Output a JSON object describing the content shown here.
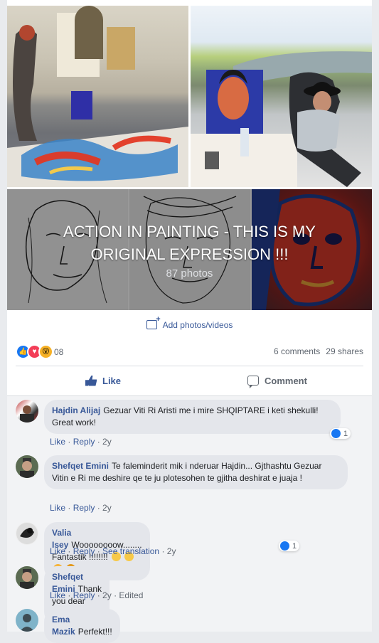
{
  "album": {
    "title": "ACTION IN PAINTING - THIS IS MY ORIGINAL EXPRESSION !!!",
    "count": "87 photos"
  },
  "post": {
    "add_photos": "Add photos/videos",
    "reaction_count": "08",
    "comments": "6 comments",
    "shares": "29 shares",
    "like_label": "Like",
    "comment_label": "Comment"
  },
  "comments": [
    {
      "name": "Hajdin Alijaj",
      "text": "Gezuar Viti Ri Aristi me i mire SHQIPTARE i keti shekulli! Great work!",
      "like": "Like",
      "reply": "Reply",
      "time": "2y",
      "reactions": "1"
    },
    {
      "name": "Shefqet Emini",
      "text": "Te faleminderit mik i nderuar Hajdin... Gjthashtu Gezuar Vitin e Ri me deshire qe te ju plotesohen te gjitha deshirat e juaja !",
      "like": "Like",
      "reply": "Reply",
      "time": "2y"
    },
    {
      "name": "Valia Isey",
      "text": "Woooooooow........ Fantastik !!!!!!!!",
      "like": "Like",
      "reply": "Reply",
      "translate": "See translation",
      "time": "2y",
      "reactions": "1"
    },
    {
      "name": "Shefqet Emini",
      "text": "Thank you dear Valia ... ))",
      "like": "Like",
      "reply": "Reply",
      "time": "2y",
      "edited": "Edited"
    },
    {
      "name": "Ema Mazik",
      "text": "Perfekt!!!"
    }
  ],
  "colors": {
    "link": "#385898",
    "bubble": "#e4e6eb",
    "like_blue": "#1877f2"
  }
}
